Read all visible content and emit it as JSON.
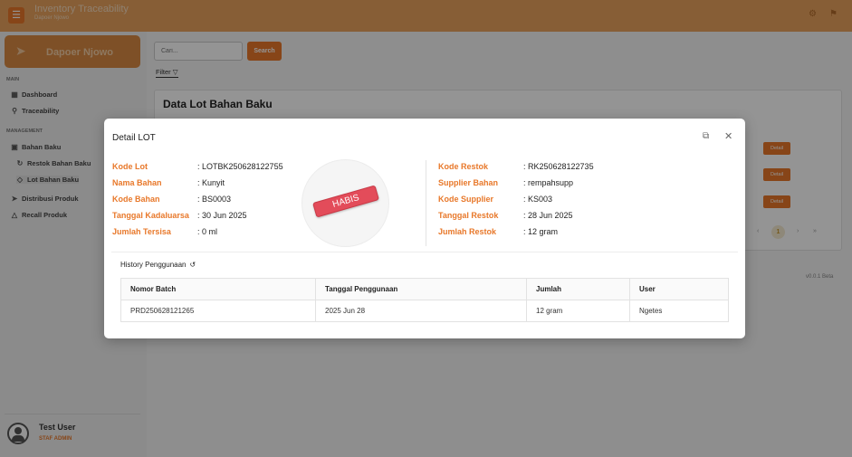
{
  "topbar": {
    "menu_icon": "menu-icon",
    "title": "Inventory Traceability",
    "subtitle": "Dapoer Njowo",
    "icons": [
      "gear-icon",
      "tag-icon"
    ]
  },
  "sidebar": {
    "brand": "Dapoer Njowo",
    "brand_icon": "fish-icon",
    "sections": [
      {
        "title": "MAIN",
        "items": [
          {
            "label": "Dashboard",
            "icon": "grid-icon"
          },
          {
            "label": "Traceability",
            "icon": "search-icon"
          }
        ]
      },
      {
        "title": "MANAGEMENT",
        "items": [
          {
            "label": "Bahan Baku",
            "icon": "box-icon"
          },
          {
            "label": "Restok Bahan Baku",
            "icon": "refresh-icon"
          },
          {
            "label": "Lot Bahan Baku",
            "icon": "tag-icon"
          },
          {
            "label": "Distribusi Produk",
            "icon": "send-icon"
          },
          {
            "label": "Recall Produk",
            "icon": "warning-icon"
          }
        ]
      }
    ],
    "active_item": "Lot Bahan Baku",
    "user": {
      "name": "Test User",
      "role": "STAF ADMIN"
    }
  },
  "main": {
    "search": {
      "placeholder": "Cari...",
      "button": "Search"
    },
    "filter_label": "Filter",
    "card_title": "Data Lot Bahan Baku",
    "detail_button": "Detail",
    "pagination": {
      "prev": "‹",
      "current": "1",
      "next": "›",
      "last": "»"
    },
    "version": "v0.0.1 Beta"
  },
  "modal": {
    "title": "Detail LOT",
    "stamp": "HABIS",
    "left_fields": [
      {
        "label": "Kode Lot",
        "value": ": LOTBK250628122755"
      },
      {
        "label": "Nama Bahan",
        "value": ": Kunyit"
      },
      {
        "label": "Kode Bahan",
        "value": ": BS0003"
      },
      {
        "label": "Tanggal Kadaluarsa",
        "value": ": 30 Jun 2025"
      },
      {
        "label": "Jumlah Tersisa",
        "value": ": 0 ml"
      }
    ],
    "right_fields": [
      {
        "label": "Kode Restok",
        "value": ": RK250628122735"
      },
      {
        "label": "Supplier Bahan",
        "value": ": rempahsupp"
      },
      {
        "label": "Kode Supplier",
        "value": ": KS003"
      },
      {
        "label": "Tanggal Restok",
        "value": ": 28 Jun 2025"
      },
      {
        "label": "Jumlah Restok",
        "value": ": 12 gram"
      }
    ],
    "history": {
      "title": "History Penggunaan",
      "columns": [
        "Nomor Batch",
        "Tanggal Penggunaan",
        "Jumlah",
        "User"
      ],
      "rows": [
        [
          "PRD250628121265",
          "2025 Jun 28",
          "12 gram",
          "Ngetes"
        ]
      ]
    }
  }
}
